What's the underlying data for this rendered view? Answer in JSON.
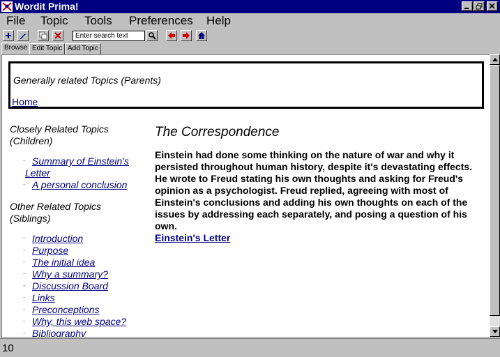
{
  "window": {
    "title": "Wordit Prima!"
  },
  "menu": [
    "File",
    "Topic",
    "Tools",
    "Preferences",
    "Help"
  ],
  "toolbar": {
    "search_placeholder": "Enter search text",
    "icons": [
      "add-icon",
      "edit-pencil-icon",
      "copy-icon",
      "delete-icon",
      "search-icon",
      "back-arrow-icon",
      "forward-arrow-icon",
      "home-icon"
    ]
  },
  "tabs": [
    "Browse",
    "Edit Topic",
    "Add Topic"
  ],
  "parents": {
    "title": "Generally related Topics (Parents)",
    "links": [
      "Home"
    ]
  },
  "children": {
    "title": "Closely Related Topics (Children)",
    "links": [
      "Summary of Einstein's Letter",
      "A personal conclusion"
    ]
  },
  "siblings": {
    "title": "Other Related Topics (Siblings)",
    "links": [
      "Introduction",
      "Purpose",
      "The initial idea",
      "Why a summary?",
      "Discussion Board",
      "Links",
      "Preconceptions",
      "Why, this web space?",
      "Bibliography"
    ]
  },
  "topic": {
    "title": "The Correspondence",
    "body": "Einstein had done some thinking on the nature of war and why it persisted throughout human history, despite it's devastating effects. He wrote to Freud stating his own thoughts and asking for Freud's opinion as a psychologist. Freud replied, agreeing with most of Einstein's conclusions and adding his own thoughts on each of the issues by addressing each separately, and posing a question of his own.",
    "link": "Einstein's Letter"
  },
  "status": {
    "text": "10"
  }
}
